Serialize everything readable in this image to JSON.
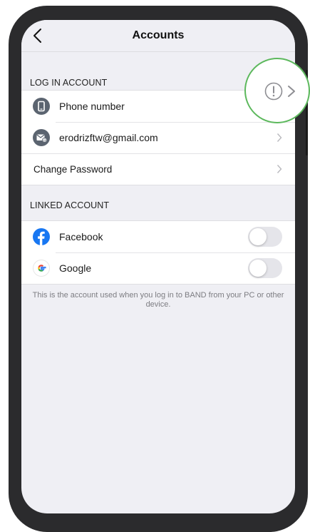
{
  "nav": {
    "title": "Accounts"
  },
  "login_section": {
    "header": "LOG IN ACCOUNT",
    "rows": [
      {
        "label": "Phone number",
        "icon": "phone-icon"
      },
      {
        "label": "erodrizftw@gmail.com",
        "icon": "email-icon"
      },
      {
        "label": "Change Password"
      }
    ]
  },
  "linked_section": {
    "header": "LINKED ACCOUNT",
    "rows": [
      {
        "label": "Facebook",
        "icon": "facebook-icon",
        "enabled": false
      },
      {
        "label": "Google",
        "icon": "google-icon",
        "enabled": false
      }
    ]
  },
  "footer_note": "This is the account used when you log in to BAND from your PC or other device.",
  "highlight": {
    "icon": "alert-icon",
    "color": "#5cb85c"
  },
  "colors": {
    "icon_gray": "#5b6470",
    "facebook": "#1877f2",
    "background": "#efeff4"
  }
}
